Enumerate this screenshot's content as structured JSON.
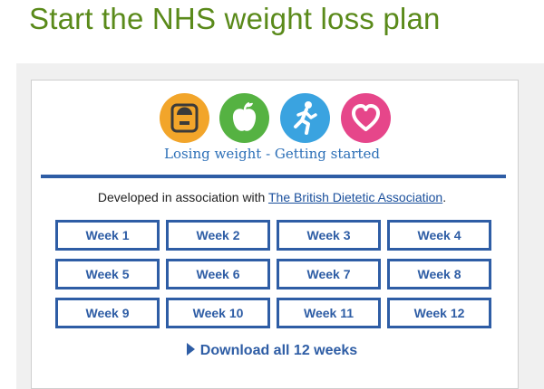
{
  "page": {
    "title": "Start the NHS weight loss plan"
  },
  "banner": {
    "icons": [
      {
        "name": "scales-icon",
        "color": "#f2a52a"
      },
      {
        "name": "apple-icon",
        "color": "#55b242"
      },
      {
        "name": "runner-icon",
        "color": "#3aa3e0"
      },
      {
        "name": "heart-icon",
        "color": "#e6468a"
      }
    ],
    "tagline": "Losing weight - Getting started"
  },
  "association": {
    "prefix": "Developed in association with ",
    "link_text": "The British Dietetic Association",
    "suffix": "."
  },
  "weeks": [
    "Week 1",
    "Week 2",
    "Week 3",
    "Week 4",
    "Week 5",
    "Week 6",
    "Week 7",
    "Week 8",
    "Week 9",
    "Week 10",
    "Week 11",
    "Week 12"
  ],
  "download": {
    "label": "Download all 12 weeks"
  }
}
